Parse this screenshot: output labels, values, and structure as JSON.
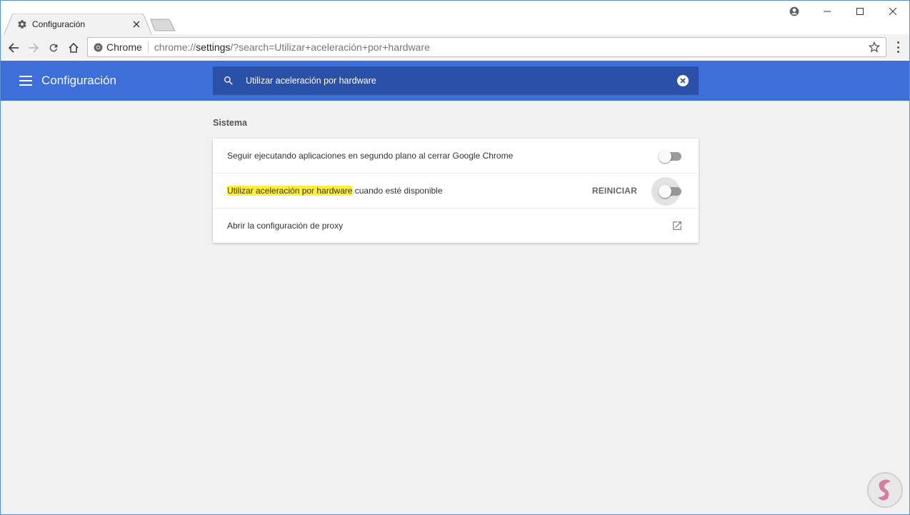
{
  "window": {
    "tab_title": "Configuración",
    "controls": [
      "profile-icon",
      "minimize-icon",
      "maximize-icon",
      "close-icon"
    ]
  },
  "toolbar": {
    "chip_label": "Chrome",
    "url_scheme": "chrome://",
    "url_host": "settings",
    "url_rest": "/?search=Utilizar+aceleración+por+hardware"
  },
  "header": {
    "title": "Configuración",
    "search_value": "Utilizar aceleración por hardware"
  },
  "section": {
    "title": "Sistema",
    "rows": [
      {
        "label": "Seguir ejecutando aplicaciones en segundo plano al cerrar Google Chrome",
        "toggle_on": false
      },
      {
        "label_highlight": "Utilizar aceleración por hardware",
        "label_rest": " cuando esté disponible",
        "action": "REINICIAR",
        "toggle_on": false
      },
      {
        "label": "Abrir la configuración de proxy",
        "icon": "open-in-new-icon"
      }
    ]
  },
  "colors": {
    "header_bg": "#3e6fd8",
    "search_bg": "#2a50a8",
    "highlight": "#ffee38",
    "page_bg": "#f1f1f1"
  }
}
